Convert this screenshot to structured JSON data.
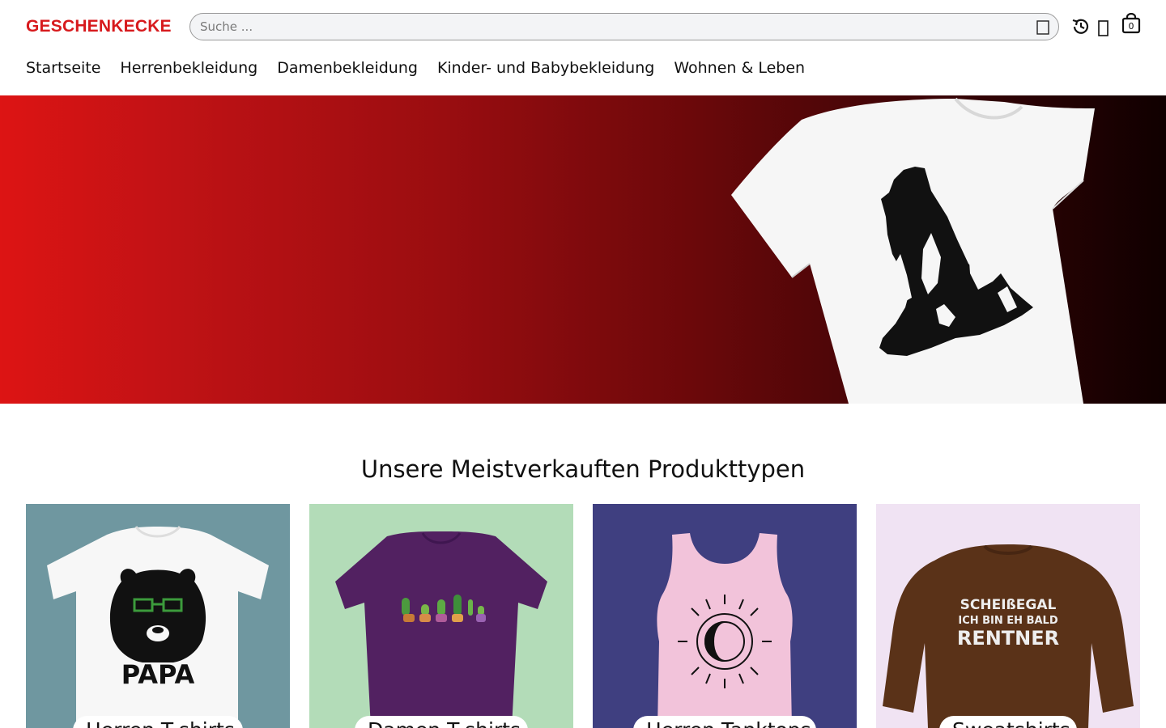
{
  "header": {
    "logo": "GESCHENKECKE",
    "search_placeholder": "Suche ...",
    "cart_count": "0",
    "icons": [
      "search-icon",
      "history-icon",
      "heart-icon",
      "shopping-bag-icon"
    ]
  },
  "nav": {
    "items": [
      {
        "label": "Startseite"
      },
      {
        "label": "Herrenbekleidung"
      },
      {
        "label": "Damenbekleidung"
      },
      {
        "label": "Kinder- und Babybekleidung"
      },
      {
        "label": "Wohnen & Leben"
      }
    ]
  },
  "hero": {
    "image": "white t-shirt with howling wolf and mountain forest print on red-to-black gradient"
  },
  "section": {
    "title": "Unsere Meistverkauften Produkttypen"
  },
  "cards": [
    {
      "label": "Herren T-shirts",
      "bg": "#6f97a0",
      "print": "PAPA"
    },
    {
      "label": "Damen T-shirts",
      "bg": "#b3dcb8"
    },
    {
      "label": "Herren Tanktops",
      "bg": "#3f3f80"
    },
    {
      "label": "Sweatshirts",
      "bg": "#f0e3f3",
      "print": [
        "SCHEIßEGAL",
        "ICH BIN EH BALD",
        "RENTNER"
      ]
    }
  ],
  "colors": {
    "brand": "#d71a1d"
  }
}
